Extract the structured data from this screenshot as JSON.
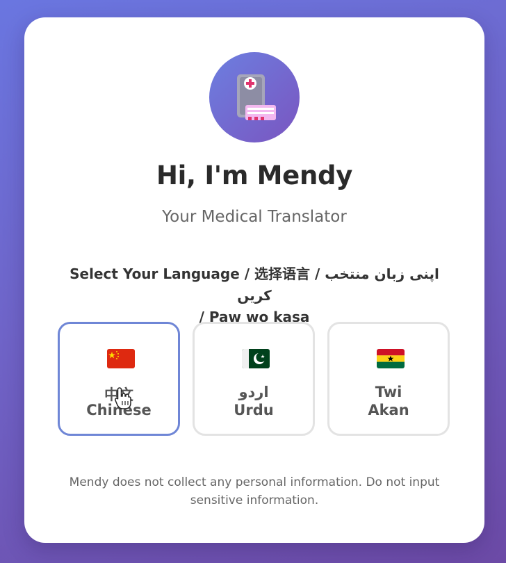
{
  "header": {
    "avatar_icon": "medical-document-icon",
    "title": "Hi, I'm Mendy",
    "subtitle": "Your Medical Translator"
  },
  "language_prompt": {
    "line1": "Select Your Language / 选择语言 / اپنی زبان منتخب کریں",
    "line2": "/ Paw wo kasa"
  },
  "languages": [
    {
      "native": "中文",
      "english": "Chinese",
      "flag": "china-flag-icon",
      "selected": true
    },
    {
      "native": "اردو",
      "english": "Urdu",
      "flag": "pakistan-flag-icon",
      "selected": false
    },
    {
      "native": "Twi",
      "english": "Akan",
      "flag": "ghana-flag-icon",
      "selected": false
    }
  ],
  "disclaimer": "Mendy does not collect any personal information. Do not input sensitive information.",
  "colors": {
    "gradient_start": "#6a76e0",
    "gradient_end": "#6c4aa6",
    "selected_border": "#6f86d6"
  }
}
